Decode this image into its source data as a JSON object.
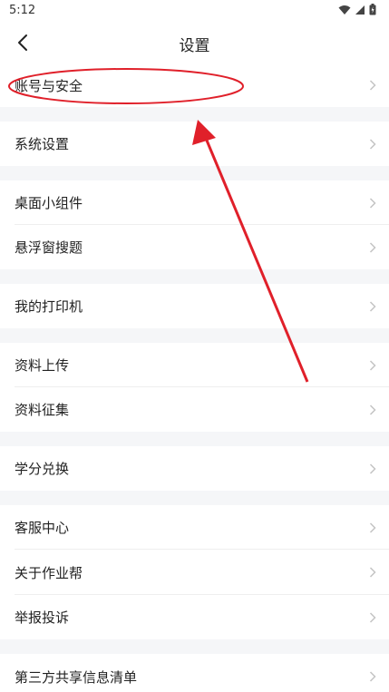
{
  "status": {
    "time": "5:12"
  },
  "header": {
    "title": "设置"
  },
  "menu": {
    "account_security": "账号与安全",
    "system_settings": "系统设置",
    "desktop_widget": "桌面小组件",
    "floating_search": "悬浮窗搜题",
    "my_printer": "我的打印机",
    "upload_materials": "资料上传",
    "collect_materials": "资料征集",
    "credit_exchange": "学分兑换",
    "customer_service": "客服中心",
    "about": "关于作业帮",
    "report": "举报投诉",
    "third_party": "第三方共享信息清单"
  },
  "colors": {
    "annotation": "#e0202a",
    "chevron": "#c4c4c4",
    "background": "#f5f6f8"
  }
}
